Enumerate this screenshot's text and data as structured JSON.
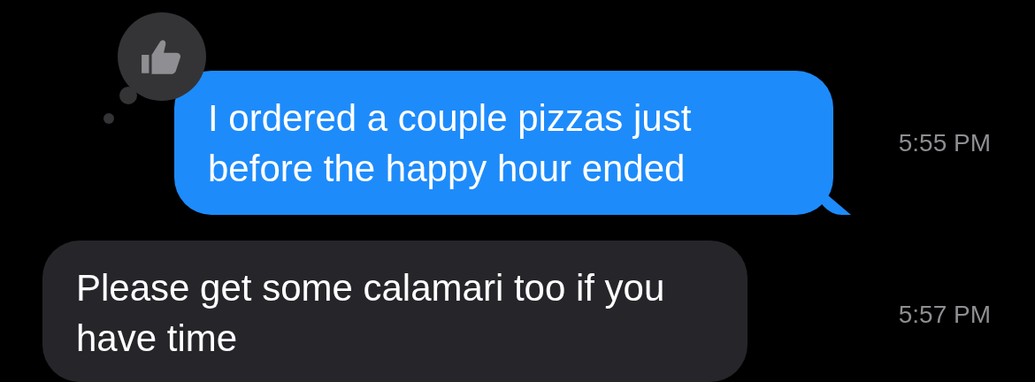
{
  "messages": [
    {
      "kind": "sent",
      "text": "I ordered a couple pizzas just before the happy hour ended",
      "time": "5:55 PM",
      "reaction": {
        "kind": "thumbs-up"
      }
    },
    {
      "kind": "received",
      "text": "Please get some calamari too if you have time",
      "time": "5:57 PM"
    }
  ]
}
